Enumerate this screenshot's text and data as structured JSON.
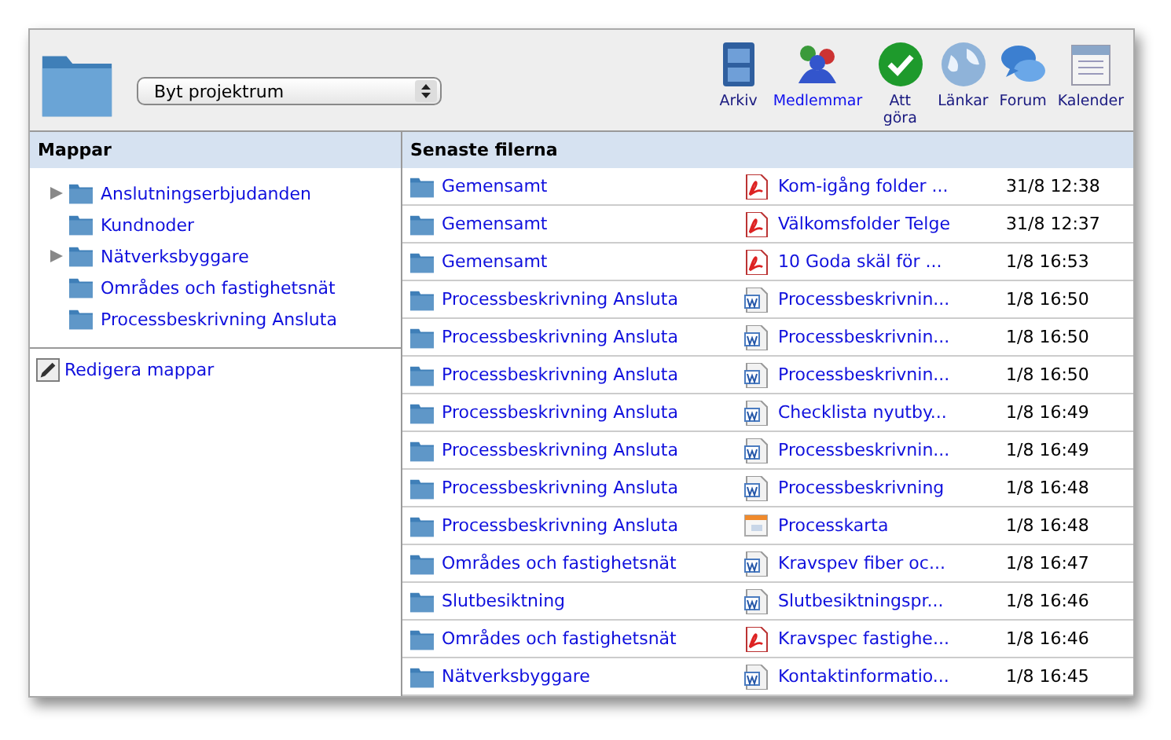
{
  "project_select": {
    "value": "Byt projektrum"
  },
  "toolbar": [
    {
      "kind": "archive",
      "label": "Arkiv",
      "selected": false
    },
    {
      "kind": "members",
      "label": "Medlemmar",
      "selected": true
    },
    {
      "kind": "todo",
      "label": "Att göra",
      "selected": false
    },
    {
      "kind": "links",
      "label": "Länkar",
      "selected": false
    },
    {
      "kind": "forum",
      "label": "Forum",
      "selected": false
    },
    {
      "kind": "calendar",
      "label": "Kalender",
      "selected": false
    }
  ],
  "folders": {
    "title": "Mappar",
    "items": [
      {
        "label": "Anslutningserbjudanden",
        "expandable": true
      },
      {
        "label": "Kundnoder",
        "expandable": false
      },
      {
        "label": "Nätverksbyggare",
        "expandable": true
      },
      {
        "label": "Områdes och fastighetsnät",
        "expandable": false
      },
      {
        "label": "Processbeskrivning Ansluta",
        "expandable": false
      }
    ],
    "edit_link": "Redigera mappar"
  },
  "recent_files": {
    "title": "Senaste filerna",
    "rows": [
      {
        "folder": "Gemensamt",
        "kind": "pdf",
        "file": "Kom-igång folder ...",
        "time": "31/8 12:38"
      },
      {
        "folder": "Gemensamt",
        "kind": "pdf",
        "file": "Välkomsfolder Telge",
        "time": "31/8 12:37"
      },
      {
        "folder": "Gemensamt",
        "kind": "pdf",
        "file": "10 Goda skäl för ...",
        "time": "1/8 16:53"
      },
      {
        "folder": "Processbeskrivning Ansluta",
        "kind": "word",
        "file": "Processbeskrivnin...",
        "time": "1/8 16:50"
      },
      {
        "folder": "Processbeskrivning Ansluta",
        "kind": "word",
        "file": "Processbeskrivnin...",
        "time": "1/8 16:50"
      },
      {
        "folder": "Processbeskrivning Ansluta",
        "kind": "word",
        "file": "Processbeskrivnin...",
        "time": "1/8 16:50"
      },
      {
        "folder": "Processbeskrivning Ansluta",
        "kind": "word",
        "file": "Checklista nyutby...",
        "time": "1/8 16:49"
      },
      {
        "folder": "Processbeskrivning Ansluta",
        "kind": "word",
        "file": "Processbeskrivnin...",
        "time": "1/8 16:49"
      },
      {
        "folder": "Processbeskrivning Ansluta",
        "kind": "word",
        "file": "Processbeskrivning",
        "time": "1/8 16:48"
      },
      {
        "folder": "Processbeskrivning Ansluta",
        "kind": "slides",
        "file": "Processkarta",
        "time": "1/8 16:48"
      },
      {
        "folder": "Områdes och fastighetsnät",
        "kind": "word",
        "file": "Kravspev fiber oc...",
        "time": "1/8 16:47"
      },
      {
        "folder": "Slutbesiktning",
        "kind": "word",
        "file": "Slutbesiktningspr...",
        "time": "1/8 16:46"
      },
      {
        "folder": "Områdes och fastighetsnät",
        "kind": "pdf",
        "file": "Kravspec fastighe...",
        "time": "1/8 16:46"
      },
      {
        "folder": "Nätverksbyggare",
        "kind": "word",
        "file": "Kontaktinformatio...",
        "time": "1/8 16:45"
      }
    ]
  }
}
